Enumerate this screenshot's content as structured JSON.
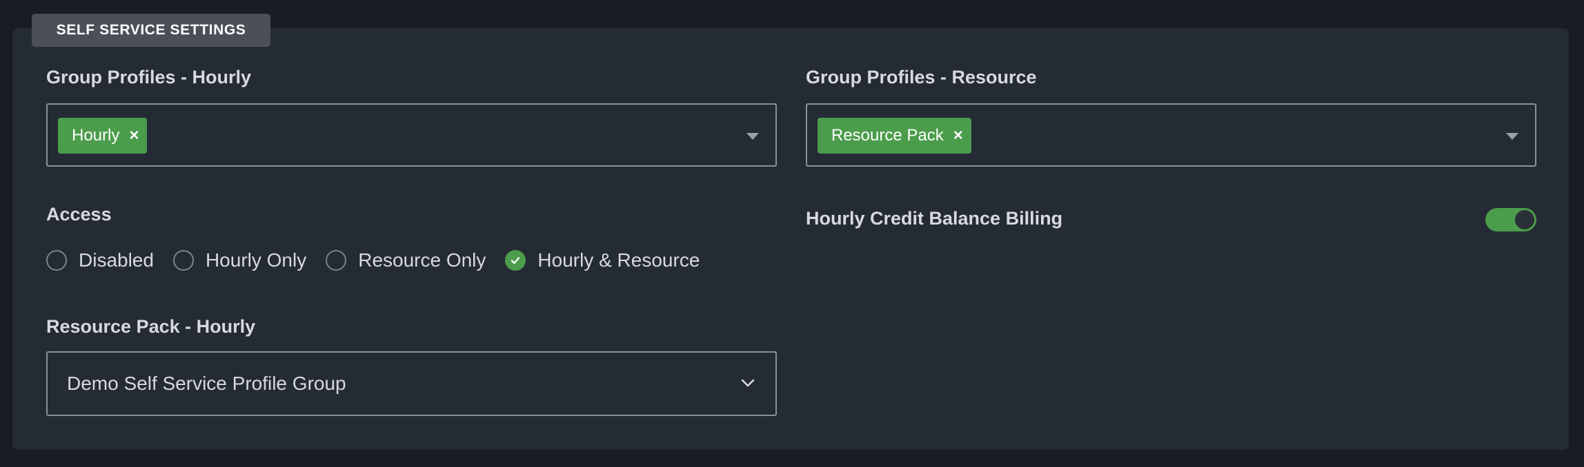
{
  "section": {
    "title": "SELF SERVICE SETTINGS"
  },
  "group_profiles_hourly": {
    "label": "Group Profiles - Hourly",
    "selected": [
      "Hourly"
    ]
  },
  "group_profiles_resource": {
    "label": "Group Profiles - Resource",
    "selected": [
      "Resource Pack"
    ]
  },
  "access": {
    "label": "Access",
    "options": [
      "Disabled",
      "Hourly Only",
      "Resource Only",
      "Hourly & Resource"
    ],
    "selected": "Hourly & Resource"
  },
  "hourly_credit_balance_billing": {
    "label": "Hourly Credit Balance Billing",
    "enabled": true
  },
  "resource_pack_hourly": {
    "label": "Resource Pack - Hourly",
    "value": "Demo Self Service Profile Group"
  },
  "colors": {
    "accent_green": "#4b9c4b",
    "panel_bg": "#252b34",
    "page_bg": "#181c24"
  }
}
